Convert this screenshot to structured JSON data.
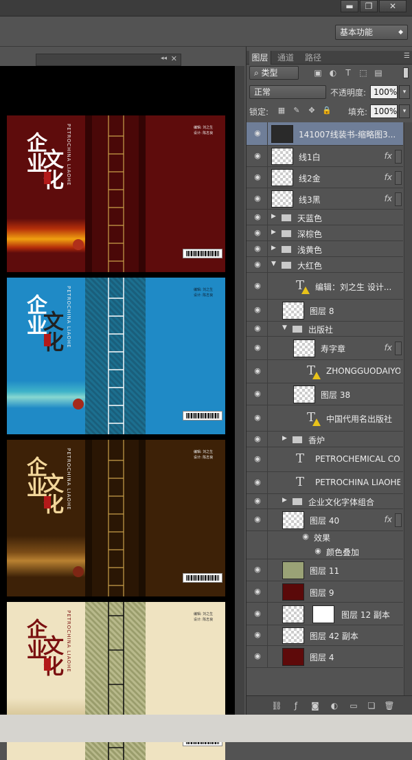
{
  "window": {
    "minimize": "▬",
    "maximize": "❐",
    "close": "✕"
  },
  "options_bar": {
    "workspace": "基本功能"
  },
  "panel": {
    "tabs": [
      "图层",
      "通道",
      "路径"
    ],
    "filter_label": "类型",
    "blend_mode": "正常",
    "opacity_label": "不透明度:",
    "opacity": "100%",
    "lock_label": "锁定:",
    "fill_label": "填充:",
    "fill": "100%"
  },
  "covers": [
    {
      "title_a": "企业",
      "title_b": "文化",
      "en": "PETROCHINA LIAOHE",
      "credits": "编辑: 刘之生\n设计: 陈志良"
    },
    {
      "title_a": "企业",
      "title_b": "文化",
      "en": "PETROCHINA LIAOHE",
      "credits": "编辑: 刘之生\n设计: 陈志良"
    },
    {
      "title_a": "企业",
      "title_b": "文化",
      "en": "PETROCHINA LIAOHE",
      "credits": "编辑: 刘之生\n设计: 陈志良"
    },
    {
      "title_a": "企业",
      "title_b": "文化",
      "en": "PETROCHINA LIAOHE",
      "credits": "编辑: 刘之生\n设计: 陈志良"
    }
  ],
  "layers": [
    {
      "name": "141007线装书-缩略图3...",
      "kind": "smart",
      "selected": true
    },
    {
      "name": "线1白",
      "kind": "pixel",
      "fx": "fx"
    },
    {
      "name": "线2金",
      "kind": "pixel",
      "fx": "fx"
    },
    {
      "name": "线3黑",
      "kind": "pixel",
      "fx": "fx"
    },
    {
      "name": "天蓝色",
      "kind": "group"
    },
    {
      "name": "深棕色",
      "kind": "group"
    },
    {
      "name": "浅黄色",
      "kind": "group"
    },
    {
      "name": "大红色",
      "kind": "group-open"
    },
    {
      "name": "编辑：刘之生 设计...",
      "kind": "text-warn"
    },
    {
      "name": "图层 8",
      "kind": "pixel"
    },
    {
      "name": "出版社",
      "kind": "group-open"
    },
    {
      "name": "寿字章",
      "kind": "smart",
      "fx": "fx"
    },
    {
      "name": "ZHONGGUODAIYO...",
      "kind": "text-warn"
    },
    {
      "name": "图层 38",
      "kind": "pixel"
    },
    {
      "name": "中国代用名出版社",
      "kind": "text-warn"
    },
    {
      "name": "香炉",
      "kind": "group"
    },
    {
      "name": "PETROCHEMICAL CO...",
      "kind": "text"
    },
    {
      "name": "PETROCHINA LIAOHE",
      "kind": "text"
    },
    {
      "name": "企业文化字体组合",
      "kind": "group"
    },
    {
      "name": "图层 40",
      "kind": "pixel",
      "fx": "fx"
    },
    {
      "name": "效果",
      "kind": "effect"
    },
    {
      "name": "颜色叠加",
      "kind": "effect-item"
    },
    {
      "name": "图层 11",
      "kind": "pixel"
    },
    {
      "name": "图层 9",
      "kind": "pixel"
    },
    {
      "name": "图层 12 副本",
      "kind": "masked"
    },
    {
      "name": "图层 42 副本",
      "kind": "pixel"
    },
    {
      "name": "图层 4",
      "kind": "pixel"
    }
  ],
  "colors": {
    "selected_row": "#6f7e98",
    "panel_bg": "#535353",
    "cover_red": "#5e0c0c",
    "cover_blue": "#1f8ac6",
    "cover_brown": "#3d2107",
    "cover_cream": "#efe3c1"
  }
}
